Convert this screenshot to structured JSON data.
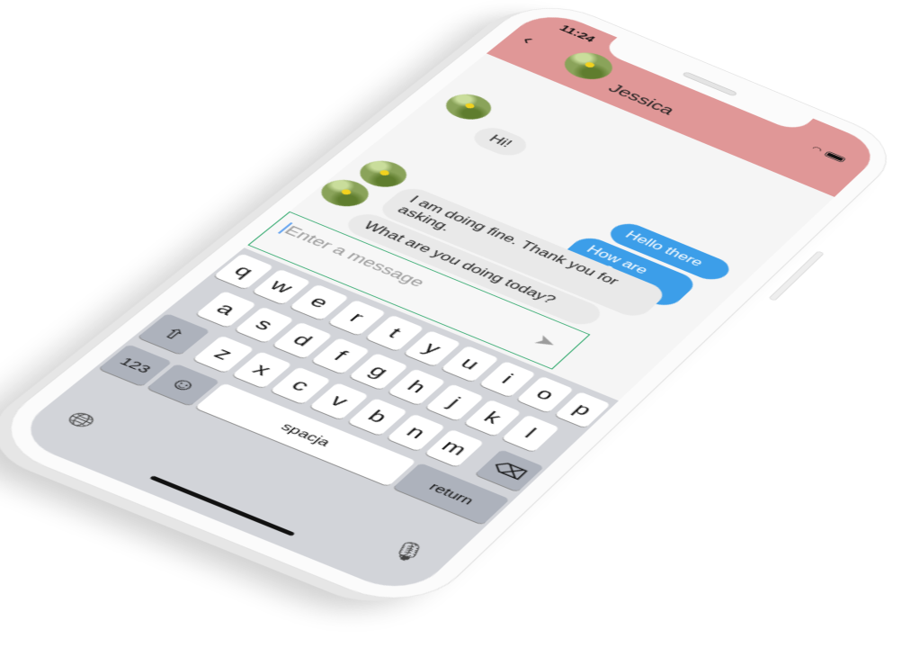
{
  "status": {
    "time": "11:24"
  },
  "header": {
    "title": "Jessica",
    "back_icon": "chevron-left-icon",
    "accent": "#e09797"
  },
  "messages": [
    {
      "from": "them",
      "text": "Hi!"
    },
    {
      "from": "me",
      "text": "Hello there"
    },
    {
      "from": "me",
      "text": "How are you?"
    },
    {
      "from": "them",
      "text": "I am doing fine. Thank you for asking."
    },
    {
      "from": "them",
      "text": "What are you doing today?"
    }
  ],
  "composer": {
    "placeholder": "Enter a message",
    "send_icon": "send-icon",
    "border_color": "#2fa86c"
  },
  "keyboard": {
    "rows": [
      [
        "q",
        "w",
        "e",
        "r",
        "t",
        "y",
        "u",
        "i",
        "o",
        "p"
      ],
      [
        "a",
        "s",
        "d",
        "f",
        "g",
        "h",
        "j",
        "k",
        "l"
      ],
      [
        "z",
        "x",
        "c",
        "v",
        "b",
        "n",
        "m"
      ]
    ],
    "shift_icon": "⇧",
    "backspace_icon": "⌫",
    "numbers_label": "123",
    "emoji_icon": "☺",
    "space_label": "spacja",
    "return_label": "return",
    "globe_icon": "🌐︎",
    "mic_icon": "🎙︎"
  },
  "colors": {
    "outgoing": "#3c9ee9",
    "incoming": "#e9e9e9",
    "keyboard": "#d2d4d9"
  }
}
